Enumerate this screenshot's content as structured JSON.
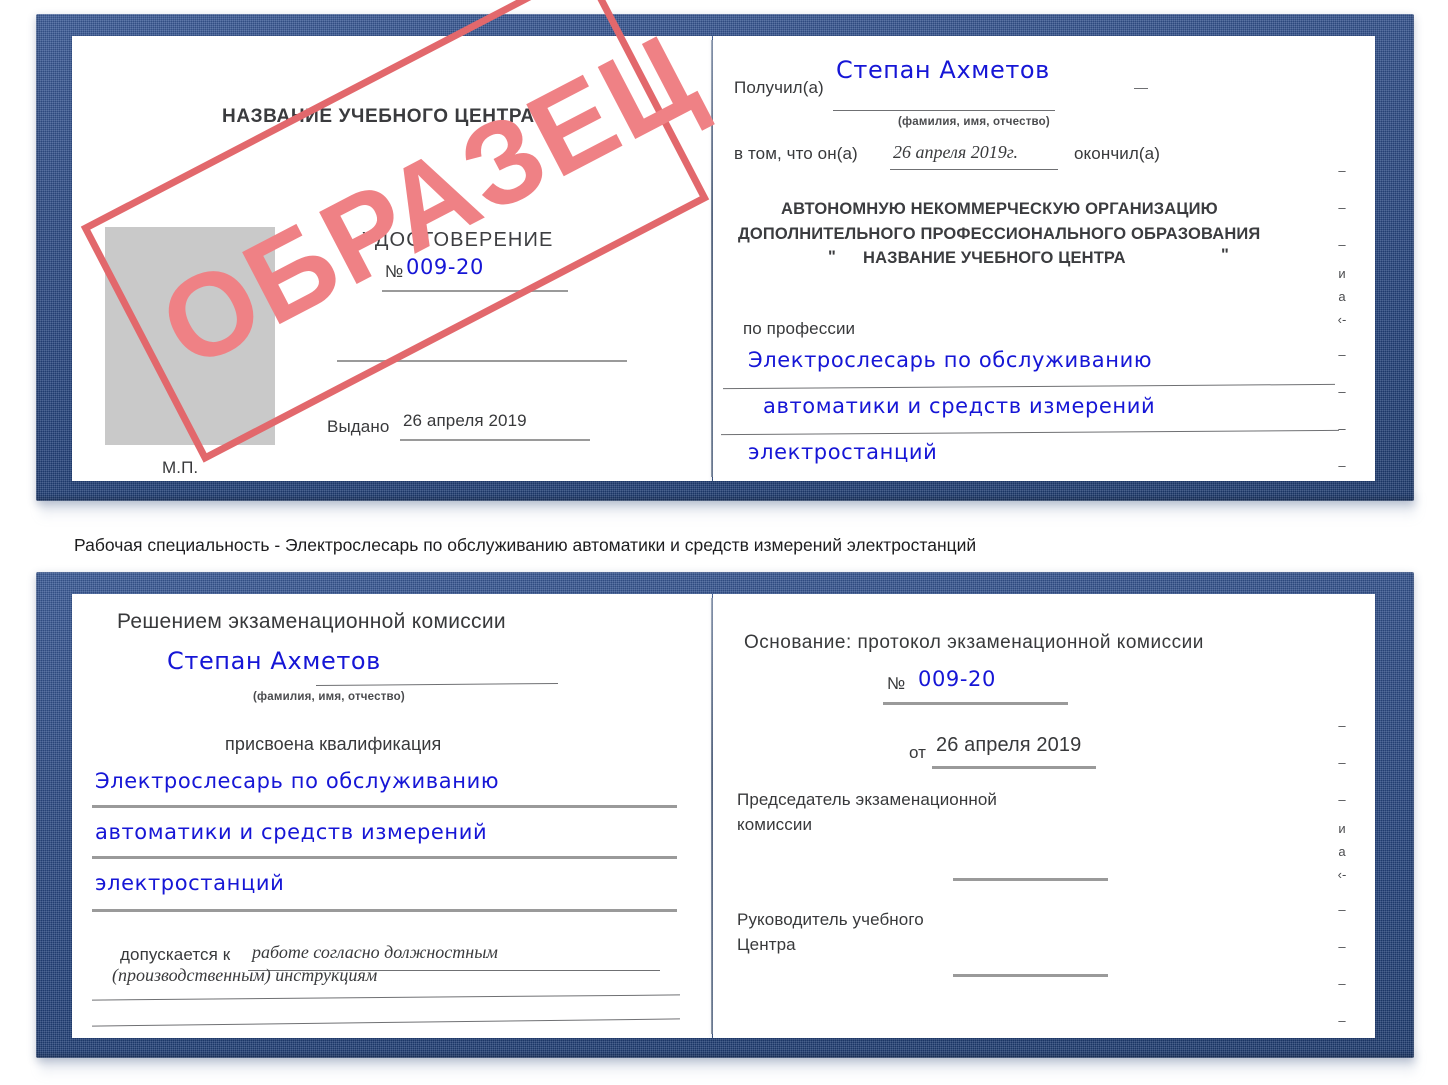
{
  "caption": "Рабочая специальность - Электрослесарь по обслуживанию автоматики и средств измерений электростанций",
  "certificate_top": {
    "left_page": {
      "center_name": "НАЗВАНИЕ УЧЕБНОГО ЦЕНТРА",
      "title": "УДОСТОВЕРЕНИЕ",
      "number_label": "№",
      "number_value": "009-20",
      "issued_label": "Выдано",
      "issued_value": "26 апреля 2019",
      "seal_label": "М.П."
    },
    "right_page": {
      "received_label": "Получил(а)",
      "received_value": "Степан Ахметов",
      "fio_hint": "(фамилия, имя, отчество)",
      "in_that_label": "в том, что он(а)",
      "date_value": "26 апреля 2019г.",
      "finished_label": "окончил(а)",
      "org_line1": "АВТОНОМНУЮ НЕКОММЕРЧЕСКУЮ ОРГАНИЗАЦИЮ",
      "org_line2": "ДОПОЛНИТЕЛЬНОГО ПРОФЕССИОНАЛЬНОГО ОБРАЗОВАНИЯ",
      "org_quote_open": "\"",
      "org_line3": "НАЗВАНИЕ УЧЕБНОГО ЦЕНТРА",
      "org_quote_close": "\"",
      "profession_label": "по профессии",
      "profession_line1": "Электрослесарь по обслуживанию",
      "profession_line2": "автоматики и средств измерений",
      "profession_line3": "электростанций"
    },
    "edge_marks": [
      "–",
      "–",
      "–",
      "и",
      "а",
      "‹-",
      "–",
      "–",
      "–",
      "–"
    ]
  },
  "certificate_bottom": {
    "left_page": {
      "heading": "Решением экзаменационной комиссии",
      "name_value": "Степан Ахметов",
      "fio_hint": "(фамилия, имя, отчество)",
      "qualification_label": "присвоена квалификация",
      "qualification_line1": "Электрослесарь по обслуживанию",
      "qualification_line2": "автоматики и средств измерений",
      "qualification_line3": "электростанций",
      "allowed_label": "допускается к",
      "allowed_value_line1": "работе согласно должностным",
      "allowed_value_line2": "(производственным) инструкциям"
    },
    "right_page": {
      "basis_label": "Основание: протокол экзаменационной комиссии",
      "number_label": "№",
      "number_value": "009-20",
      "from_label": "от",
      "from_value": "26 апреля 2019",
      "chairman_line1": "Председатель экзаменационной",
      "chairman_line2": "комиссии",
      "head_line1": "Руководитель учебного",
      "head_line2": "Центра"
    },
    "edge_marks": [
      "–",
      "–",
      "–",
      "и",
      "а",
      "‹-",
      "–",
      "–",
      "–",
      "–"
    ]
  },
  "stamp": {
    "text": "ОБРАЗЕЦ",
    "border_color": "#e2686c",
    "text_color": "#ef8185"
  },
  "colors": {
    "cover_blue": "#2c4a84",
    "handwriting_blue": "#1616d6",
    "photo_gray": "#c9c9c9",
    "rule_gray": "#9a9a9a"
  }
}
